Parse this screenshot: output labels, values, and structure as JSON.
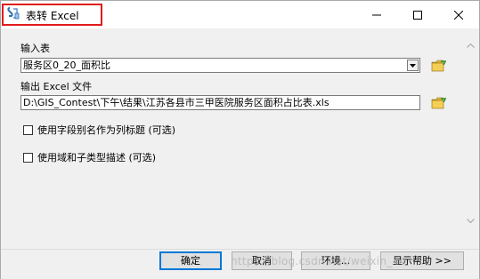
{
  "window": {
    "title": "表转 Excel",
    "icon": "table-to-excel-tool-icon",
    "controls": {
      "minimize": "minimize-icon",
      "maximize": "maximize-icon",
      "close": "close-icon"
    }
  },
  "form": {
    "input_table_label": "输入表",
    "input_table_value": "服务区0_20_面积比",
    "output_file_label": "输出 Excel 文件",
    "output_file_value": "D:\\GIS_Contest\\下午\\结果\\江苏各县市三甲医院服务区面积占比表.xls",
    "checkbox_alias_label": "使用字段别名作为列标题 (可选)",
    "checkbox_alias_checked": false,
    "checkbox_domain_label": "使用域和子类型描述 (可选)",
    "checkbox_domain_checked": false
  },
  "buttons": {
    "ok": "确定",
    "cancel": "取消",
    "environments": "环境...",
    "show_help": "显示帮助 >>"
  },
  "watermark": "https://blog.csdn.net/weixin_44"
}
